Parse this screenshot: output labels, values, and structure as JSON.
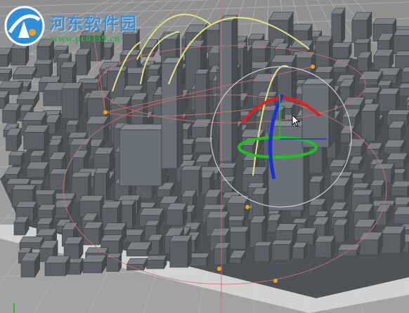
{
  "watermark": {
    "title": "河东软件园",
    "url": "www.pc0359.cn"
  },
  "viewport": {
    "grid": true,
    "icons": {
      "logo": "circular-logo-icon",
      "cursor": "mouse-pointer-icon",
      "axis": "axis-gizmo-icon",
      "rotate_gizmo": "rotate-gizmo-icon"
    },
    "colors": {
      "background": "#9a9a9a",
      "grid": "#b4b4b4",
      "buildings": "#5a5f64",
      "bounding_lines": "#e06a6a",
      "light_arcs": "#e8e07a",
      "gizmo_x": "#e02020",
      "gizmo_y": "#20c020",
      "gizmo_z": "#1a30e0",
      "gizmo_view": "#d0d0d0",
      "handles": "#f0a020"
    }
  }
}
